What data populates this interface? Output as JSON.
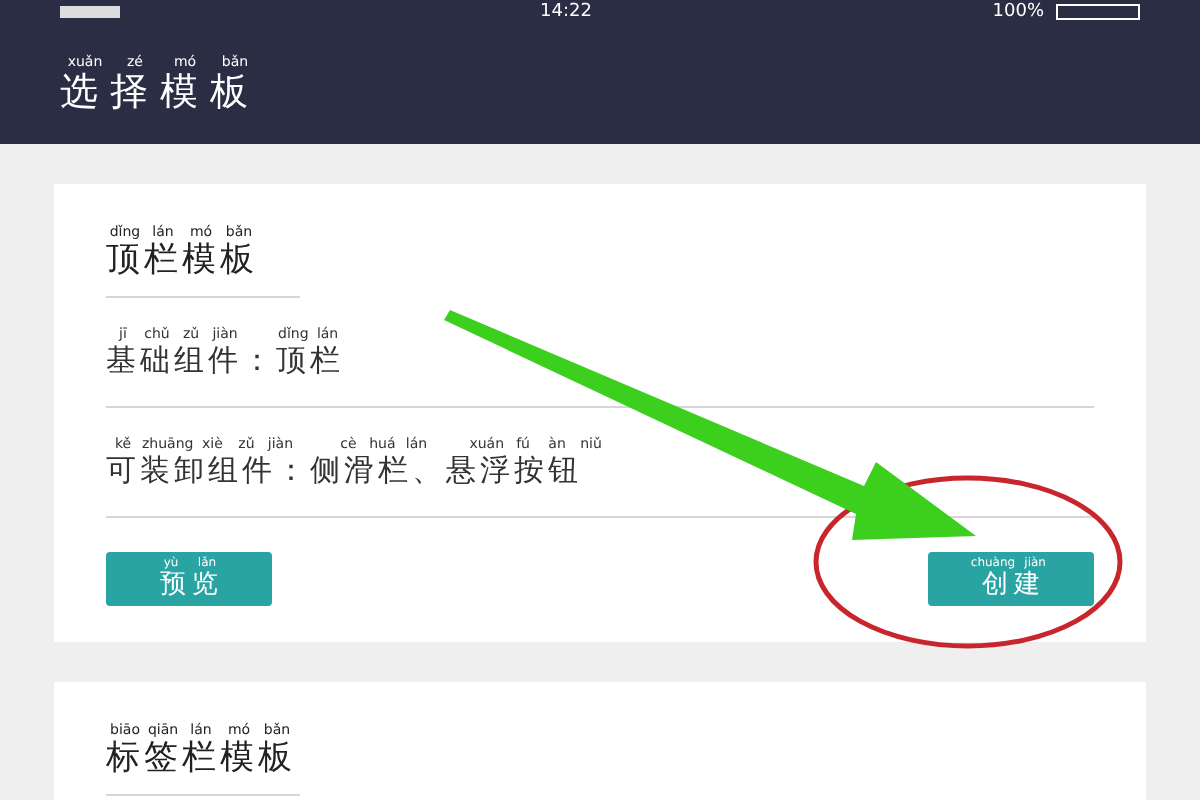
{
  "status_bar": {
    "time": "14:22",
    "battery": "100%"
  },
  "header": {
    "title": {
      "segments": [
        {
          "text": "选择模板",
          "pinyin": "xuǎn zé mó bǎn"
        }
      ]
    }
  },
  "cards": [
    {
      "title": {
        "segments": [
          {
            "text": "顶栏模板",
            "pinyin": "dǐng lán mó bǎn"
          }
        ]
      },
      "rows": [
        {
          "segments": [
            {
              "text": "基础组件",
              "pinyin": "jī chǔ zǔ jiàn"
            },
            {
              "text": "："
            },
            {
              "text": "顶栏",
              "pinyin": "dǐng lán"
            }
          ]
        },
        {
          "segments": [
            {
              "text": "可装卸组件",
              "pinyin": "kě zhuāng xiè zǔ jiàn"
            },
            {
              "text": "："
            },
            {
              "text": "侧滑栏",
              "pinyin": "cè huá lán"
            },
            {
              "text": "、"
            },
            {
              "text": "悬浮按钮",
              "pinyin": "xuán fú àn niǔ"
            }
          ]
        }
      ],
      "buttons": [
        {
          "segments": [
            {
              "text": "预览",
              "pinyin": "yù lǎn"
            }
          ]
        },
        {
          "segments": [
            {
              "text": "创建",
              "pinyin": "chuàng jiàn"
            }
          ]
        }
      ]
    },
    {
      "title": {
        "segments": [
          {
            "text": "标签栏模板",
            "pinyin": "biāo qiān lán mó bǎn"
          }
        ]
      }
    }
  ]
}
